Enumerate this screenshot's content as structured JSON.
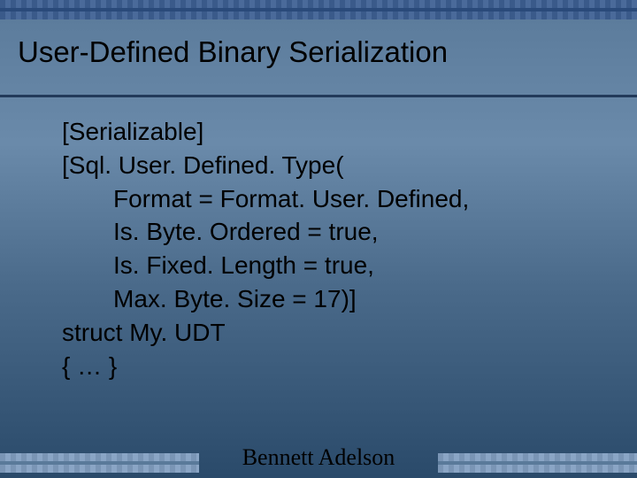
{
  "title": "User-Defined Binary Serialization",
  "code": {
    "l1": "[Serializable]",
    "l2": "[Sql. User. Defined. Type(",
    "l3": "Format = Format. User. Defined,",
    "l4": "Is. Byte. Ordered = true,",
    "l5": "Is. Fixed. Length = true,",
    "l6": "Max. Byte. Size = 17)]",
    "l7": "struct My. UDT",
    "l8": "{ … }"
  },
  "footer": "Bennett Adelson"
}
